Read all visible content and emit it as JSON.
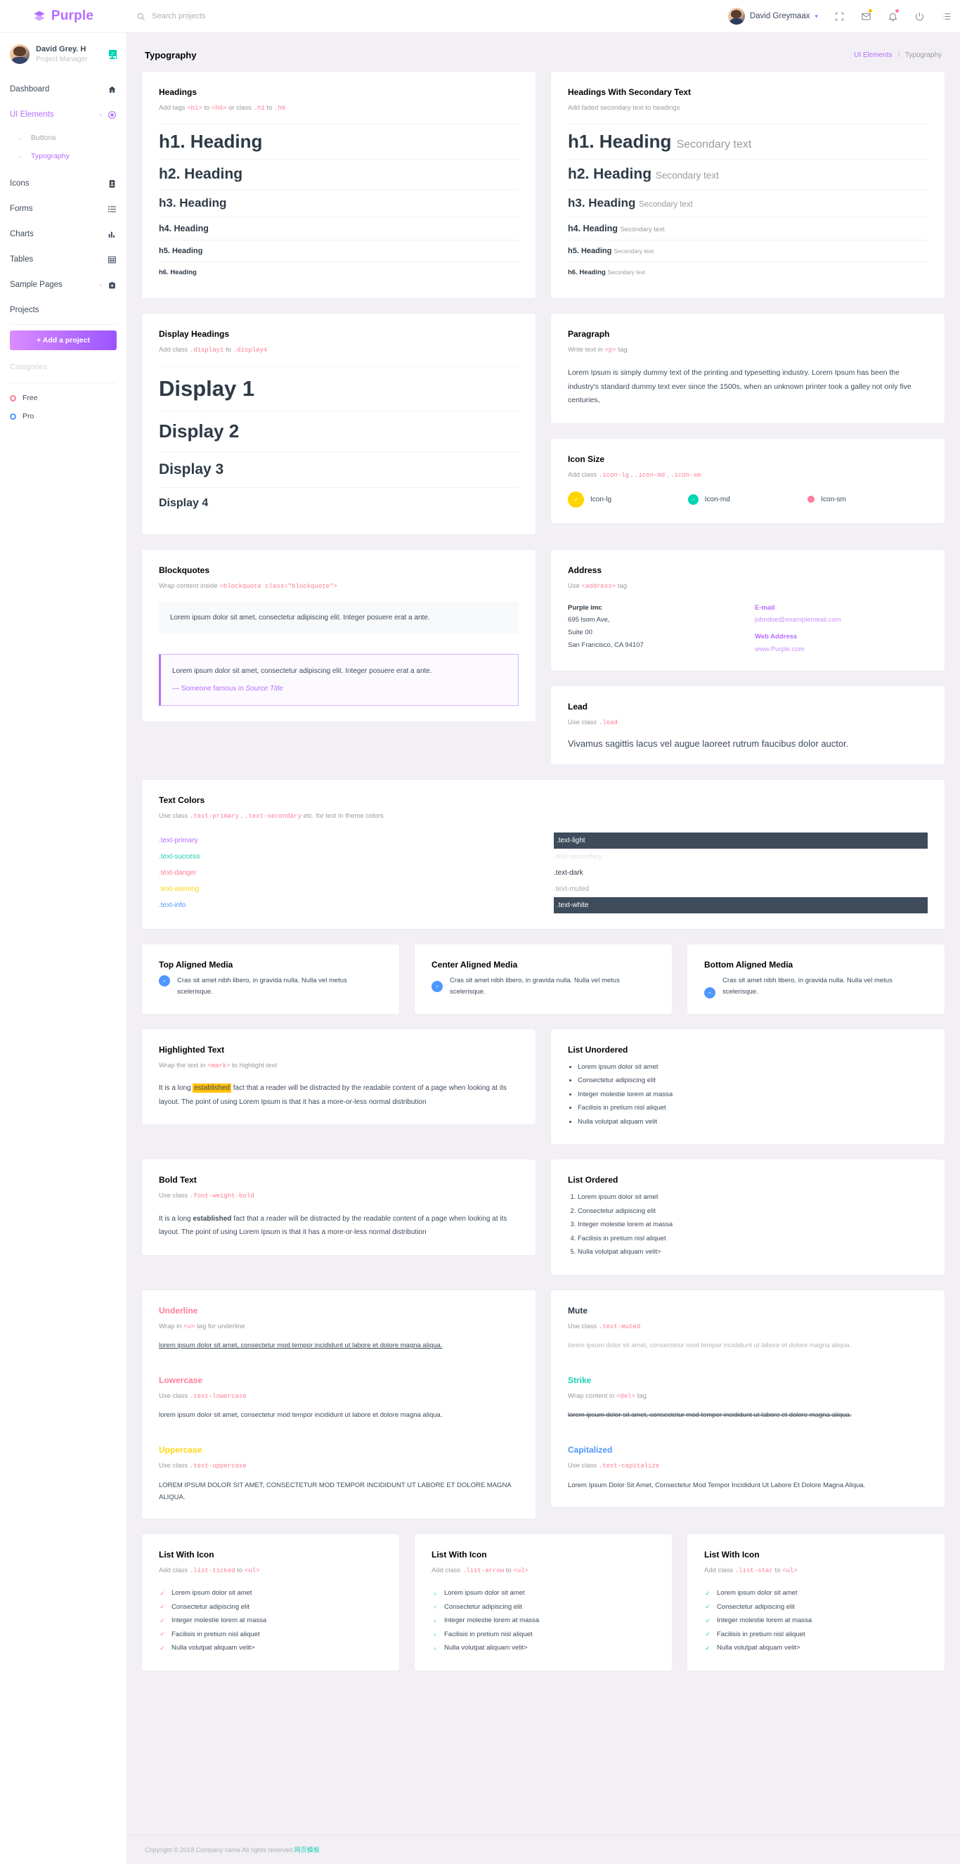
{
  "brand": {
    "name": "Purple"
  },
  "navbar": {
    "search_placeholder": "Search projects",
    "profile_name": "David Greymaax",
    "icons": [
      "grid-icon",
      "mail-icon",
      "bell-icon",
      "power-icon",
      "list-icon"
    ]
  },
  "sidebar": {
    "profile": {
      "name": "David Grey. H",
      "role": "Project Manager"
    },
    "items": [
      {
        "label": "Dashboard",
        "icon": "home-icon",
        "active": false
      },
      {
        "label": "UI Elements",
        "icon": "target-icon",
        "active": true
      },
      {
        "label": "Icons",
        "icon": "contact-icon",
        "active": false
      },
      {
        "label": "Forms",
        "icon": "list-icon",
        "active": false
      },
      {
        "label": "Charts",
        "icon": "chart-icon",
        "active": false
      },
      {
        "label": "Tables",
        "icon": "table-icon",
        "active": false
      },
      {
        "label": "Sample Pages",
        "icon": "medical-bag-icon",
        "active": false
      }
    ],
    "submenu": [
      {
        "label": "Buttons",
        "active": false
      },
      {
        "label": "Typography",
        "active": true
      }
    ],
    "projects_label": "Projects",
    "add_project_label": "+ Add a project",
    "categories_label": "Categories",
    "categories": [
      {
        "label": "Free",
        "color": "#fe7c96"
      },
      {
        "label": "Pro",
        "color": "#4f97ff"
      }
    ]
  },
  "page": {
    "title": "Typography",
    "breadcrumb_root": "UI Elements",
    "breadcrumb_current": "Typography"
  },
  "headings_card": {
    "title": "Headings",
    "sub_pre": "Add tags",
    "sub_tag1": "<h1>",
    "sub_mid": "to",
    "sub_tag2": "<h6>",
    "sub_or": "or class",
    "sub_cls1": ".h1",
    "sub_to": "to",
    "sub_cls2": ".h6",
    "rows": [
      "h1. Heading",
      "h2. Heading",
      "h3. Heading",
      "h4. Heading",
      "h5. Heading",
      "h6. Heading"
    ]
  },
  "headings_secondary_card": {
    "title": "Headings With Secondary Text",
    "sub": "Add faded secondary text to headings",
    "secondary_label": "Secondary text",
    "rows": [
      "h1. Heading",
      "h2. Heading",
      "h3. Heading",
      "h4. Heading",
      "h5. Heading",
      "h6. Heading"
    ]
  },
  "display_card": {
    "title": "Display Headings",
    "sub_pre": "Add class",
    "sub_cls1": ".display1",
    "sub_to": "to",
    "sub_cls2": ".display4",
    "rows": [
      "Display 1",
      "Display 2",
      "Display 3",
      "Display 4"
    ]
  },
  "paragraph_card": {
    "title": "Paragraph",
    "sub_pre": "Write text in",
    "sub_tag": "<p>",
    "sub_post": "tag",
    "body": "Lorem Ipsum is simply dummy text of the printing and typesetting industry. Lorem Ipsum has been the industry's standard dummy text ever since the 1500s, when an unknown printer took a galley not only five centuries,"
  },
  "icon_size_card": {
    "title": "Icon Size",
    "sub_pre": "Add class",
    "cls_lg": ".icon-lg",
    "cls_md": ".icon-md",
    "cls_sm": ".icon-sm",
    "items": [
      {
        "label": "Icon-lg",
        "color": "#ffd500"
      },
      {
        "label": "Icon-md",
        "color": "#00d5b5"
      },
      {
        "label": "Icon-sm",
        "color": "#fe7c96"
      }
    ]
  },
  "blockquote_card": {
    "title": "Blockquotes",
    "sub_pre": "Wrap content inside",
    "sub_tag": "<blockquote class=\"blockquote\">",
    "quote_plain": "Lorem ipsum dolor sit amet, consectetur adipiscing elit. Integer posuere erat a ante.",
    "quote_primary": "Lorem ipsum dolor sit amet, consectetur adipiscing elit. Integer posuere erat a ante.",
    "quote_footer_pre": "— Someone famous in",
    "quote_footer_cite": "Source Title"
  },
  "address_card": {
    "title": "Address",
    "sub_pre": "Use",
    "sub_tag": "<address>",
    "sub_post": "tag",
    "company": "Purple imc",
    "line1": "695 lsom Ave,",
    "line2": "Suite 00",
    "line3": "San Francisco, CA 94107",
    "email_label": "E-mail",
    "email_value": "johndoe@examplemeail.com",
    "web_label": "Web Address",
    "web_value": "www.Purple.com"
  },
  "lead_card": {
    "title": "Lead",
    "sub_pre": "Use class",
    "sub_cls": ".lead",
    "body": "Vivamus sagittis lacus vel augue laoreet rutrum faucibus dolor auctor."
  },
  "text_colors_card": {
    "title": "Text Colors",
    "sub_pre": "Use class",
    "sub_cls1": ".text-primary",
    "sub_cls2": ".text-secondary",
    "sub_post": "etc. for text in theme colors",
    "left": [
      {
        "label": ".text-primary",
        "cls": "t-primary",
        "boxed": false
      },
      {
        "label": ".text-success",
        "cls": "t-success",
        "boxed": false
      },
      {
        "label": ".text-danger",
        "cls": "t-danger",
        "boxed": false
      },
      {
        "label": ".text-warning",
        "cls": "t-warning",
        "boxed": false
      },
      {
        "label": ".text-info",
        "cls": "t-info",
        "boxed": false
      }
    ],
    "right": [
      {
        "label": ".text-light",
        "cls": "t-light",
        "boxed": true
      },
      {
        "label": ".text-secondary",
        "cls": "t-secondary",
        "boxed": false
      },
      {
        "label": ".text-dark",
        "cls": "t-dark",
        "boxed": false
      },
      {
        "label": ".text-muted",
        "cls": "t-muted",
        "boxed": false
      },
      {
        "label": ".text-white",
        "cls": "t-white",
        "boxed": true
      }
    ]
  },
  "media_cards": [
    {
      "title": "Top Aligned Media",
      "body": "Cras sit amet nibh libero, in gravida nulla. Nulla vel metus scelerisque."
    },
    {
      "title": "Center Aligned Media",
      "body": "Cras sit amet nibh libero, in gravida nulla. Nulla vel metus scelerisque."
    },
    {
      "title": "Bottom Aligned Media",
      "body": "Cras sit amet nibh libero, in gravida nulla. Nulla vel metus scelerisque."
    }
  ],
  "highlight_card": {
    "title": "Highlighted Text",
    "sub_pre": "Wrap the text in",
    "sub_tag": "<mark>",
    "sub_post": "to highlight text",
    "body_pre": "It is a long ",
    "body_mark": "established",
    "body_post": " fact that a reader will be distracted by the readable content of a page when looking at its layout. The point of using Lorem Ipsum is that it has a more-or-less normal distribution"
  },
  "bold_card": {
    "title": "Bold Text",
    "sub_pre": "Use class",
    "sub_cls": ".font-weight-bold",
    "body_pre": "It is a long ",
    "body_bold": "established",
    "body_post": " fact that a reader will be distracted by the readable content of a page when looking at its layout. The point of using Lorem Ipsum is that it has a more-or-less normal distribution"
  },
  "list_unordered_card": {
    "title": "List Unordered",
    "items": [
      "Lorem ipsum dolor sit amet",
      "Consectetur adipiscing elit",
      "Integer molestie lorem at massa",
      "Facilisis in pretium nisl aliquet",
      "Nulla volutpat aliquam velit"
    ]
  },
  "list_ordered_card": {
    "title": "List Ordered",
    "items": [
      "Lorem ipsum dolor sit amet",
      "Consectetur adipiscing elit",
      "Integer molestie lorem at massa",
      "Facilisis in pretium nisl aliquet",
      "Nulla volutpat aliquam velit>"
    ]
  },
  "decorations_left": [
    {
      "title": "Underline",
      "title_cls": "dec-underline",
      "sub_pre": "Wrap in",
      "sub_tag": "<u>",
      "sub_post": "tag for underline",
      "body": "lorem ipsum dolor sit amet, consectetur mod tempor incididunt ut labore et dolore magna aliqua.",
      "body_cls": "u"
    },
    {
      "title": "Lowercase",
      "title_cls": "dec-lower",
      "sub_pre": "Use class",
      "sub_tag": ".text-lowercase",
      "sub_post": "",
      "body": "lorem ipsum dolor sit amet, consectetur mod tempor incididunt ut labore et dolore magna aliqua.",
      "body_cls": "lc"
    },
    {
      "title": "Uppercase",
      "title_cls": "dec-upper",
      "sub_pre": "Use class",
      "sub_tag": ".text-uppercase",
      "sub_post": "",
      "body": "Lorem ipsum dolor sit amet, consectetur mod tempor incididunt ut labore et dolore magna aliqua.",
      "body_cls": "uc"
    }
  ],
  "decorations_right": [
    {
      "title": "Mute",
      "title_cls": "dec-mute",
      "sub_pre": "Use class",
      "sub_tag": ".text-muted",
      "sub_post": "",
      "body": "lorem ipsum dolor sit amet, consectetur mod tempor incididunt ut labore et dolore magna aliqua.",
      "body_cls": "muted"
    },
    {
      "title": "Strike",
      "title_cls": "dec-strike",
      "sub_pre": "Wrap content in",
      "sub_tag": "<del>",
      "sub_post": "tag",
      "body": "lorem ipsum dolor sit amet, consectetur mod tempor incididunt ut labore et dolore magna aliqua.",
      "body_cls": "strike"
    },
    {
      "title": "Capitalized",
      "title_cls": "dec-cap",
      "sub_pre": "Use class",
      "sub_tag": ".text-capitalize",
      "sub_post": "",
      "body": "Lorem ipsum dolor sit amet, consectetur mod tempor incididunt ut labore et dolore magna aliqua.",
      "body_cls": "capz"
    }
  ],
  "list_icon_cards": [
    {
      "title": "List With Icon",
      "sub_pre": "Add class",
      "sub_cls": ".list-ticked",
      "sub_to": "to",
      "sub_tag": "<ul>",
      "style": "li-ticked",
      "glyph": "✓",
      "items": [
        "Lorem ipsum dolor sit amet",
        "Consectetur adipiscing elit",
        "Integer molestie lorem at massa",
        "Facilisis in pretium nisl aliquet",
        "Nulla volutpat aliquam velit>"
      ]
    },
    {
      "title": "List With Icon",
      "sub_pre": "Add class",
      "sub_cls": ".list-arrow",
      "sub_to": "to",
      "sub_tag": "<ul>",
      "style": "li-arrow",
      "glyph": "›",
      "items": [
        "Lorem ipsum dolor sit amet",
        "Consectetur adipiscing elit",
        "Integer molestie lorem at massa",
        "Facilisis in pretium nisl aliquet",
        "Nulla volutpat aliquam velit>"
      ]
    },
    {
      "title": "List With Icon",
      "sub_pre": "Add class",
      "sub_cls": ".list-star",
      "sub_to": "to",
      "sub_tag": "<ul>",
      "style": "li-star",
      "glyph": "✓",
      "items": [
        "Lorem ipsum dolor sit amet",
        "Consectetur adipiscing elit",
        "Integer molestie lorem at massa",
        "Facilisis in pretium nisl aliquet",
        "Nulla volutpat aliquam velit>"
      ]
    }
  ],
  "footer": {
    "text": "Copyright © 2018.Company name All rights reserved.",
    "highlight": "网页模板"
  }
}
